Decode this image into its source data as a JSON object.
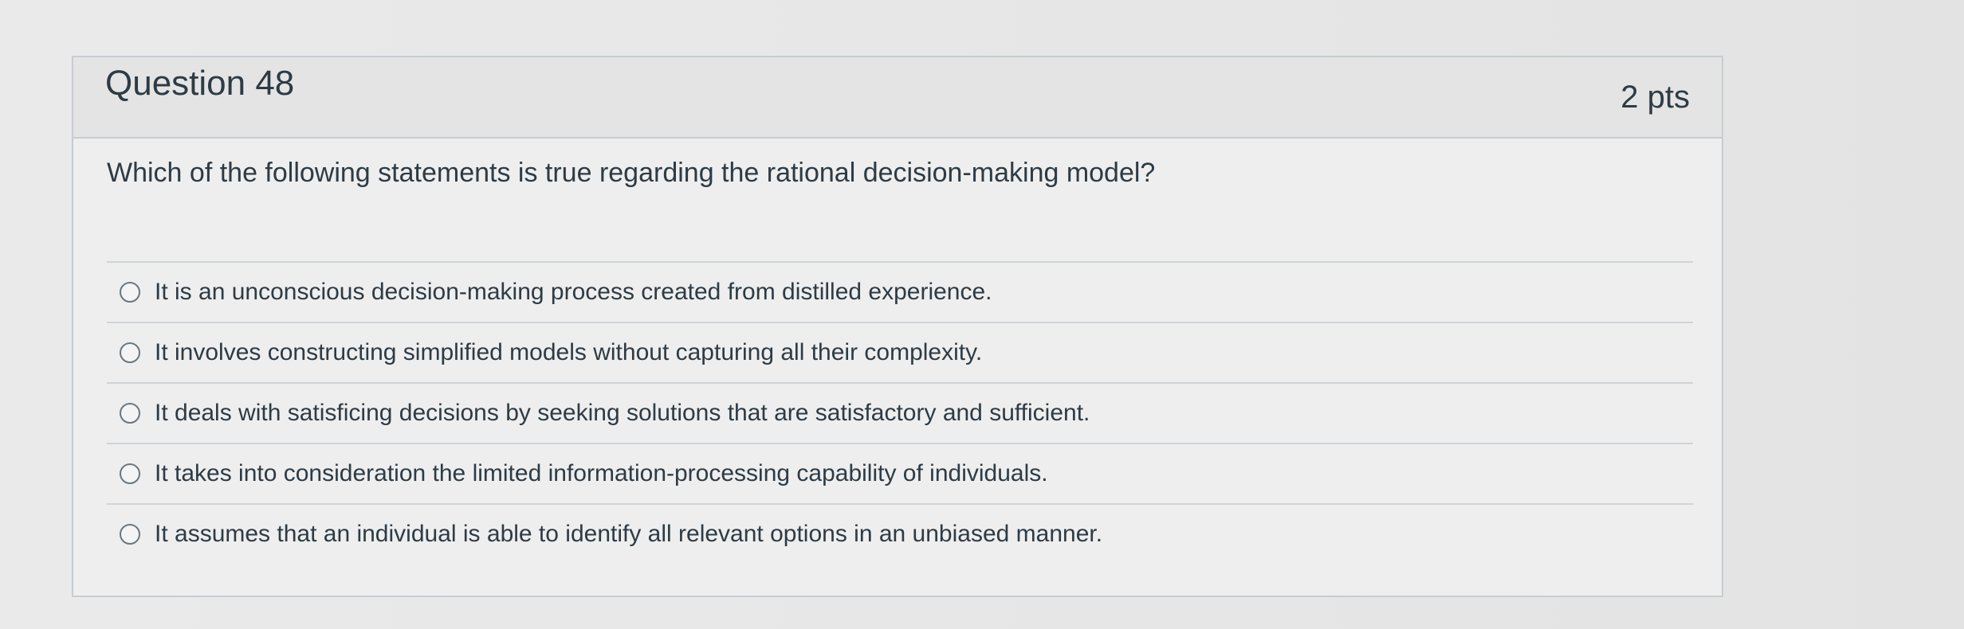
{
  "question": {
    "title": "Question 48",
    "points": "2 pts",
    "text": "Which of the following statements is true regarding the rational decision-making model?",
    "answers": [
      {
        "label": "It is an unconscious decision-making process created from distilled experience."
      },
      {
        "label": "It involves constructing simplified models without capturing all their complexity."
      },
      {
        "label": "It deals with satisficing decisions by seeking solutions that are satisfactory and sufficient."
      },
      {
        "label": "It takes into consideration the limited information-processing capability of individuals."
      },
      {
        "label": "It assumes that an individual is able to identify all relevant options in an unbiased manner."
      }
    ]
  },
  "colors": {
    "text": "#2d3b45",
    "border": "#c7cdd1",
    "header_bg": "#e4e4e4"
  }
}
